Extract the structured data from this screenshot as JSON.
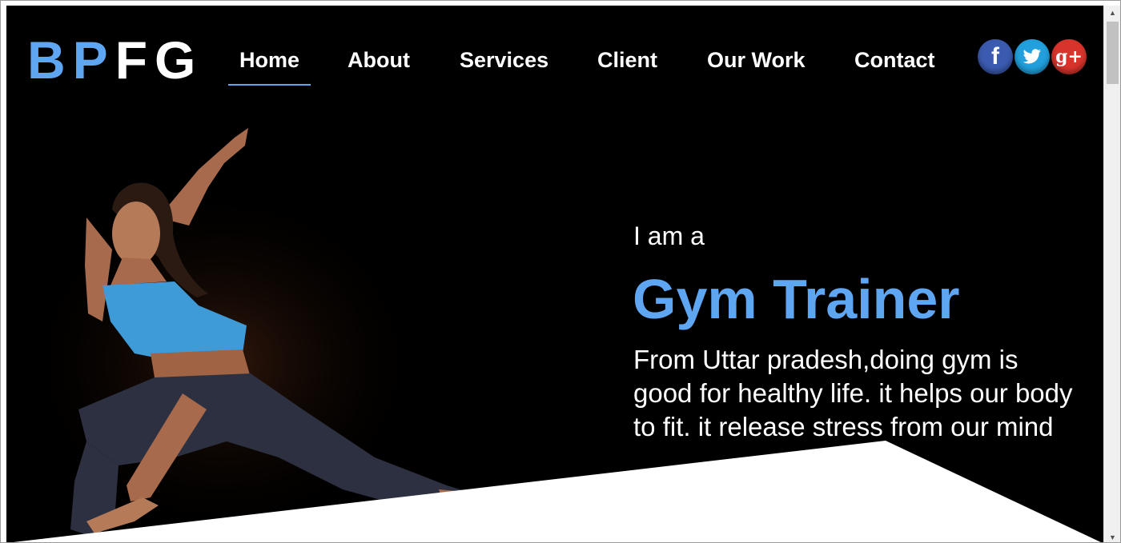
{
  "logo": {
    "part_blue": "BP",
    "part_white": "FG"
  },
  "nav": {
    "items": [
      {
        "label": "Home",
        "active": true
      },
      {
        "label": "About",
        "active": false
      },
      {
        "label": "Services",
        "active": false
      },
      {
        "label": "Client",
        "active": false
      },
      {
        "label": "Our Work",
        "active": false
      },
      {
        "label": "Contact",
        "active": false
      }
    ]
  },
  "social": {
    "icons": [
      "facebook-icon",
      "twitter-icon",
      "google-plus-icon"
    ],
    "facebook_glyph": "f",
    "google_glyph": "g+"
  },
  "hero": {
    "intro": "I am a",
    "headline": "Gym Trainer",
    "description": "From Uttar pradesh,doing gym is good for healthy life. it helps our body to fit. it release stress from our mind"
  },
  "colors": {
    "accent": "#5ea6f2",
    "background": "#000000",
    "facebook": "#3b5bb0",
    "twitter": "#21a0dd",
    "google_plus": "#d8342b"
  }
}
